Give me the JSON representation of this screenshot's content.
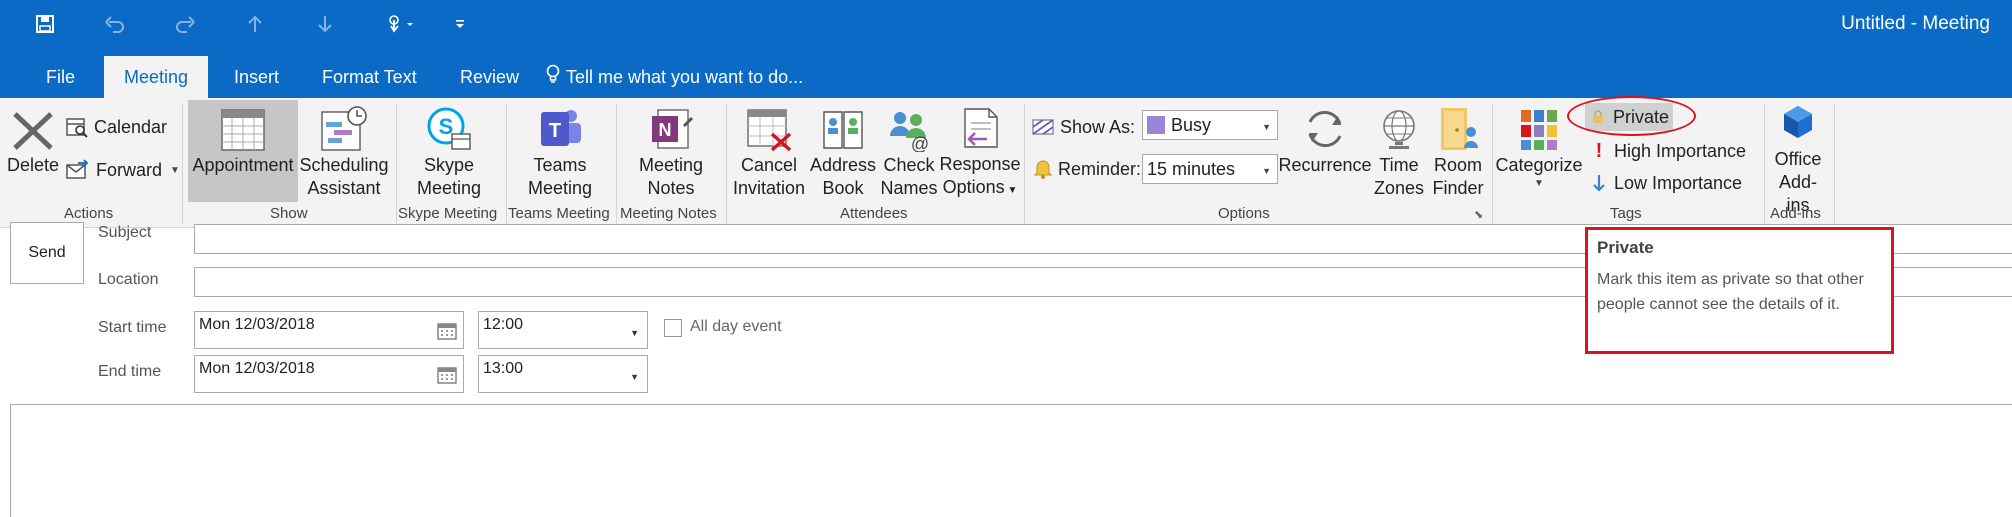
{
  "window": {
    "title": "Untitled - Meeting",
    "accent_color": "#0a6ac5"
  },
  "quick_access": {
    "icons": [
      "save-icon",
      "undo-icon",
      "redo-icon",
      "up-arrow-icon",
      "down-arrow-icon",
      "touch-mode-icon",
      "customize-toolbar-icon"
    ]
  },
  "tabs": [
    {
      "label": "File"
    },
    {
      "label": "Meeting",
      "active": true
    },
    {
      "label": "Insert"
    },
    {
      "label": "Format Text"
    },
    {
      "label": "Review"
    }
  ],
  "tell_me": {
    "label": "Tell me what you want to do..."
  },
  "ribbon": {
    "actions": {
      "group_label": "Actions",
      "delete": "Delete",
      "calendar": "Calendar",
      "forward": "Forward"
    },
    "show": {
      "group_label": "Show",
      "appointment": "Appointment",
      "scheduling_line1": "Scheduling",
      "scheduling_line2": "Assistant"
    },
    "skype": {
      "group_label": "Skype Meeting",
      "line1": "Skype",
      "line2": "Meeting"
    },
    "teams": {
      "group_label": "Teams Meeting",
      "line1": "Teams",
      "line2": "Meeting"
    },
    "meeting_notes": {
      "group_label": "Meeting Notes",
      "line1": "Meeting",
      "line2": "Notes"
    },
    "attendees": {
      "group_label": "Attendees",
      "cancel_line1": "Cancel",
      "cancel_line2": "Invitation",
      "address_line1": "Address",
      "address_line2": "Book",
      "check_line1": "Check",
      "check_line2": "Names",
      "response_line1": "Response",
      "response_line2": "Options"
    },
    "options": {
      "group_label": "Options",
      "show_as_label": "Show As:",
      "show_as_value": "Busy",
      "show_as_color": "#9b85d6",
      "reminder_label": "Reminder:",
      "reminder_value": "15 minutes",
      "recurrence": "Recurrence",
      "time_zones_line1": "Time",
      "time_zones_line2": "Zones",
      "room_finder_line1": "Room",
      "room_finder_line2": "Finder"
    },
    "tags": {
      "group_label": "Tags",
      "categorize": "Categorize",
      "private": "Private",
      "high_importance": "High Importance",
      "low_importance": "Low Importance"
    },
    "addins": {
      "group_label": "Add-ins",
      "line1": "Office",
      "line2": "Add-ins"
    }
  },
  "form": {
    "send": "Send",
    "subject_label": "Subject",
    "subject_value": "",
    "location_label": "Location",
    "location_value": "",
    "start_label": "Start time",
    "start_date": "Mon 12/03/2018",
    "start_time": "12:00",
    "end_label": "End time",
    "end_date": "Mon 12/03/2018",
    "end_time": "13:00",
    "all_day_label": "All day event",
    "all_day_checked": false
  },
  "tooltip": {
    "title": "Private",
    "description": "Mark this item as private so that other people cannot see the details of it."
  },
  "highlight_color": "#d8141c"
}
